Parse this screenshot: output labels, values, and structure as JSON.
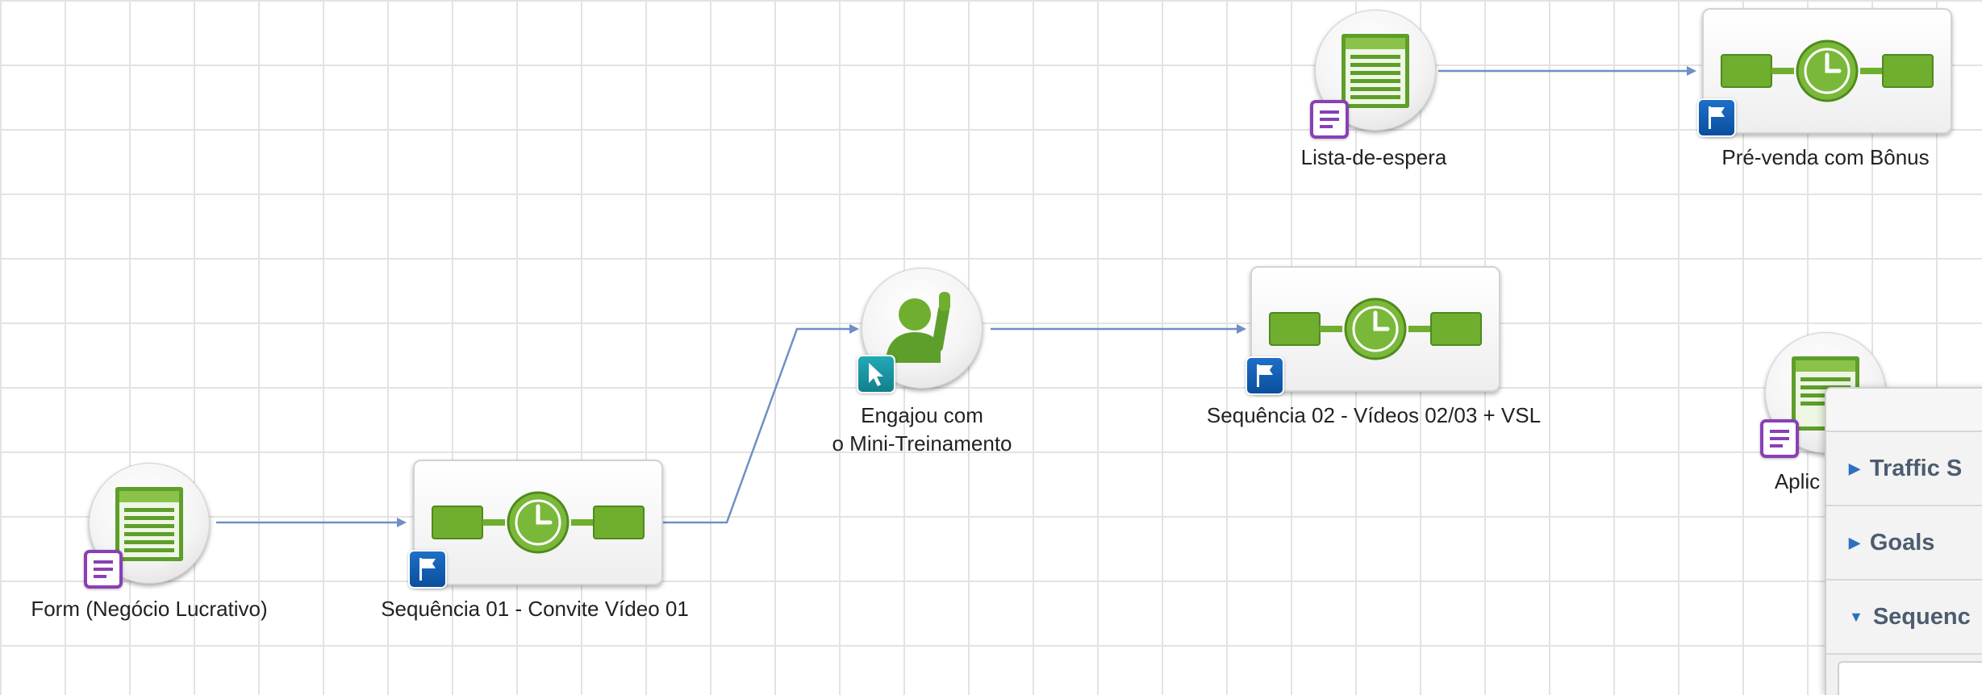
{
  "nodes": {
    "form_negocio": {
      "label": "Form (Negócio Lucrativo)",
      "icon": "form-page-icon",
      "badge": "form-badge-icon"
    },
    "sequencia_01": {
      "label": "Sequência 01 - Convite Vídeo 01",
      "icon": "timer-sequence-icon",
      "badge": "flag-badge-icon"
    },
    "engajou": {
      "label_line1": "Engajou com",
      "label_line2": "o Mini-Treinamento",
      "icon": "person-raising-hand-icon",
      "badge": "cursor-badge-icon"
    },
    "sequencia_02": {
      "label": "Sequência 02 - Vídeos 02/03 + VSL",
      "icon": "timer-sequence-icon",
      "badge": "flag-badge-icon"
    },
    "lista_espera": {
      "label": "Lista-de-espera",
      "icon": "form-page-icon",
      "badge": "form-badge-icon"
    },
    "pre_venda": {
      "label": "Pré-venda com Bônus",
      "icon": "timer-sequence-icon",
      "badge": "flag-badge-icon"
    },
    "aplic": {
      "label": "Aplic",
      "icon": "form-page-icon",
      "badge": "form-badge-icon"
    }
  },
  "panel": {
    "items": [
      {
        "label": "Traffic S",
        "expanded": false
      },
      {
        "label": "Goals",
        "expanded": false
      },
      {
        "label": "Sequenc",
        "expanded": true
      }
    ]
  },
  "colors": {
    "connector": "#6f8fc6",
    "green": "#6fae2f",
    "form_badge": "#8a3fb5",
    "flag_badge": "#0b4f9e",
    "cursor_badge": "#11808c",
    "panel_text": "#4d5d70"
  }
}
